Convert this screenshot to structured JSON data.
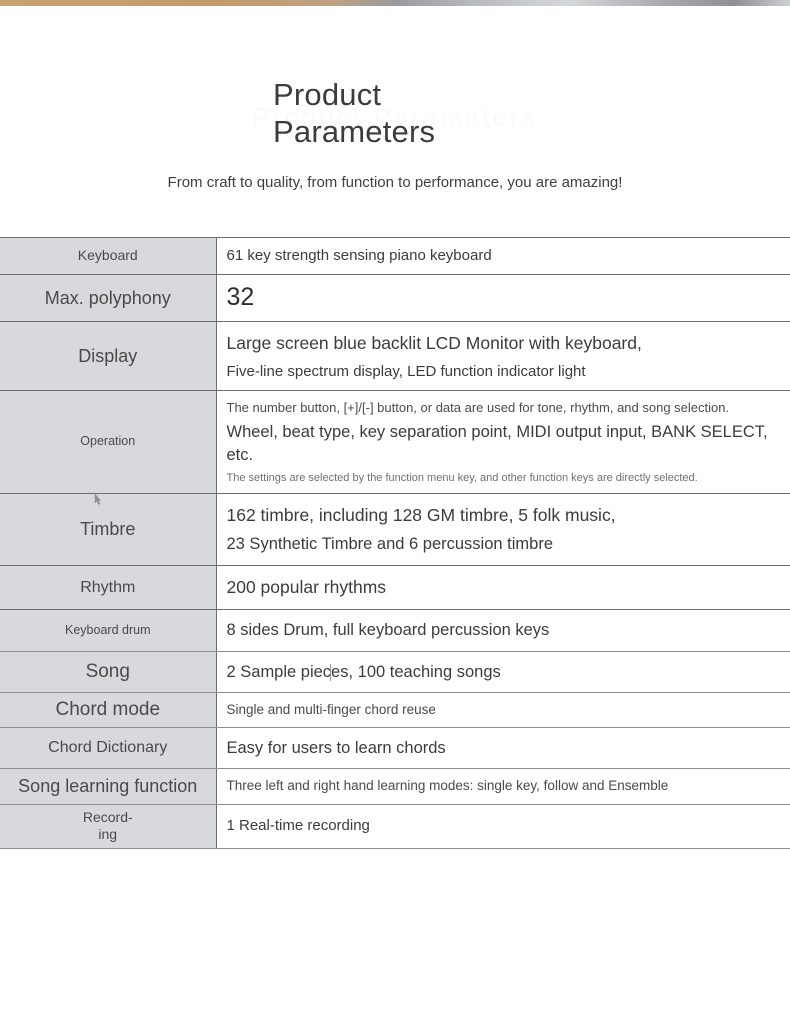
{
  "top_strip": {
    "description": "photo-edge-sliver",
    "left_color": "#c49a6c",
    "right_color": "#9a9a9c"
  },
  "header": {
    "title": "Product Parameters",
    "watermark": "Product Parameters",
    "subtitle": "From craft to quality, from function to performance, you are amazing!"
  },
  "spec_table": {
    "rows": [
      {
        "label": "Keyboard",
        "label_size": "sm",
        "values": [
          {
            "text": "61 key strength sensing piano keyboard",
            "size": "md"
          }
        ]
      },
      {
        "label": "Max. polyphony",
        "label_size": "lg",
        "values": [
          {
            "text": "32",
            "size": "huge"
          }
        ]
      },
      {
        "label": "Display",
        "label_size": "lg",
        "values": [
          {
            "text": "Large screen blue backlit LCD Monitor with keyboard,",
            "size": "xl"
          },
          {
            "text": "Five-line spectrum display, LED function indicator light",
            "size": "md"
          }
        ]
      },
      {
        "label": "Operation",
        "label_size": "xs",
        "values": [
          {
            "text": "The number button, [+]/[-] button, or data are used for tone, rhythm, and song selection.",
            "size": "sm"
          },
          {
            "text": "Wheel, beat type, key separation point, MIDI output input, BANK SELECT, etc.",
            "size": "lg"
          },
          {
            "text": "The settings are selected by the function menu key, and other function keys are directly selected.",
            "size": "xs"
          }
        ]
      },
      {
        "label": "Timbre",
        "label_size": "lg",
        "values": [
          {
            "text": "162 timbre, including 128 GM timbre, 5 folk music,",
            "size": "xl"
          },
          {
            "text": "23 Synthetic Timbre and 6 percussion timbre",
            "size": "lg"
          }
        ]
      },
      {
        "label": "Rhythm",
        "label_size": "md",
        "values": [
          {
            "text": "200 popular rhythms",
            "size": "xl"
          }
        ]
      },
      {
        "label": "Keyboard drum",
        "label_size": "xs",
        "values": [
          {
            "text": "8 sides Drum, full keyboard percussion keys",
            "size": "lg"
          }
        ]
      },
      {
        "label": "Song",
        "label_size": "xl",
        "values": [
          {
            "text": "2 Sample pieces, 100 teaching songs",
            "size": "lg"
          }
        ]
      },
      {
        "label": "Chord mode",
        "label_size": "xl",
        "values": [
          {
            "text": "Single and multi-finger chord reuse",
            "size": "smm"
          }
        ]
      },
      {
        "label": "Chord Dictionary",
        "label_size": "md",
        "values": [
          {
            "text": "Easy for users to learn chords",
            "size": "lg"
          }
        ]
      },
      {
        "label": "Song learning function",
        "label_size": "lg",
        "values": [
          {
            "text": "Three left and right hand learning modes: single key, follow and Ensemble",
            "size": "smm"
          }
        ]
      },
      {
        "label": "Record-\ning",
        "label_size": "sm",
        "values": [
          {
            "text": "1 Real-time recording",
            "size": "md"
          }
        ]
      }
    ]
  },
  "artifacts": {
    "cursor_icon": "mouse-pointer-icon",
    "caret_icon": "text-caret-icon"
  }
}
